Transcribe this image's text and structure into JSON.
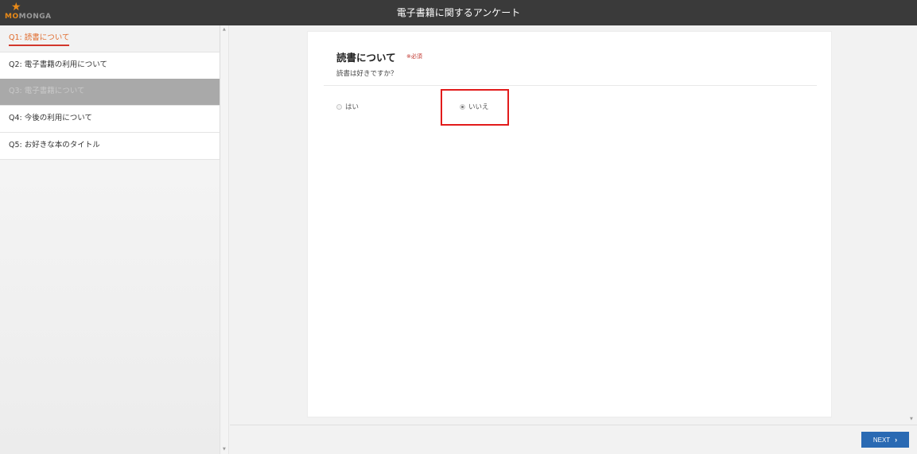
{
  "app": {
    "title": "電子書籍に関するアンケート",
    "logo_text_first": "MO",
    "logo_text_rest": "MONGA"
  },
  "sidebar": {
    "items": [
      {
        "label": "Q1: 読書について",
        "state": "active"
      },
      {
        "label": "Q2: 電子書籍の利用について",
        "state": "normal"
      },
      {
        "label": "Q3: 電子書籍について",
        "state": "disabled"
      },
      {
        "label": "Q4: 今後の利用について",
        "state": "normal"
      },
      {
        "label": "Q5: お好きな本のタイトル",
        "state": "normal"
      }
    ]
  },
  "question": {
    "title": "読書について",
    "required_mark": "※必須",
    "text": "読書は好きですか？",
    "options": [
      {
        "label": "はい",
        "selected": false
      },
      {
        "label": "いいえ",
        "selected": true
      }
    ]
  },
  "footer": {
    "next_label": "NEXT",
    "next_chevron": "›"
  },
  "colors": {
    "accent": "#2a6ab3",
    "active_nav_text": "#e06a2b",
    "highlight": "#e21b1b"
  }
}
